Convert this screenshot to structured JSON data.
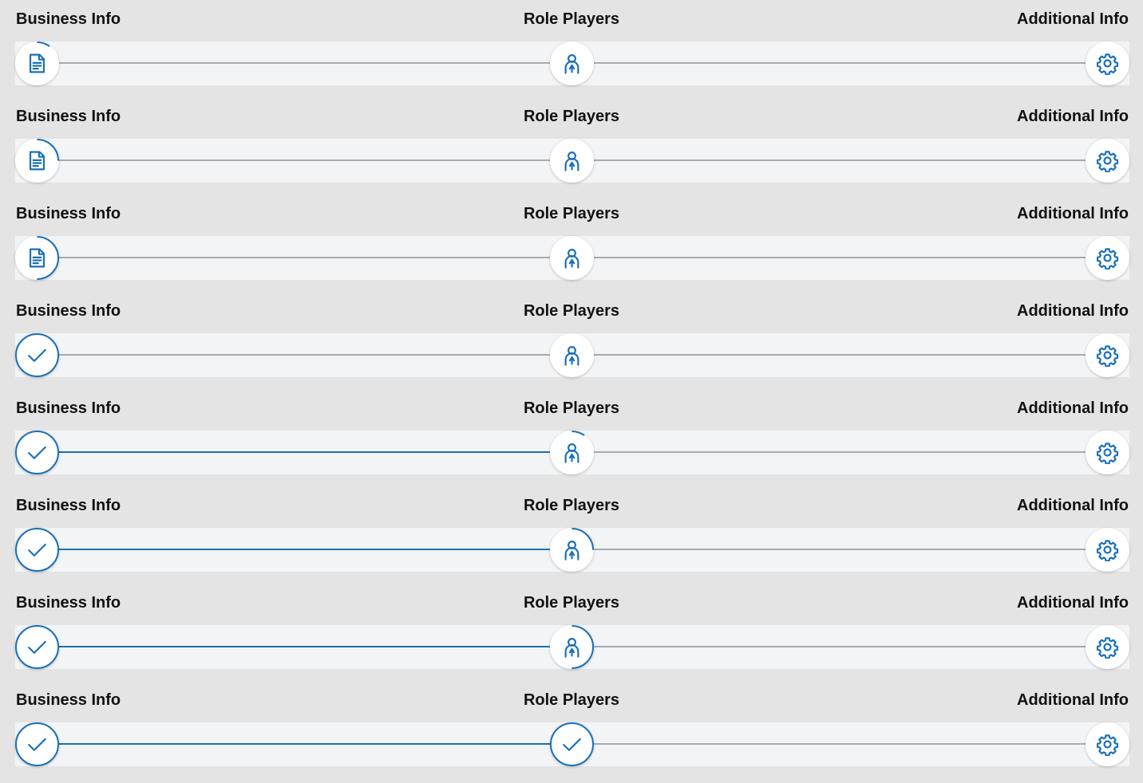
{
  "colors": {
    "accent": "#1a70b8",
    "connector_inactive": "#a7abb0",
    "track": "#f3f4f6",
    "background": "#e4e4e4"
  },
  "steppers": [
    {
      "steps": [
        {
          "label": "Business Info",
          "icon": "document-icon",
          "progress": 0.1
        },
        {
          "label": "Role Players",
          "icon": "person-icon",
          "progress": 0
        },
        {
          "label": "Additional Info",
          "icon": "gear-icon",
          "progress": 0
        }
      ],
      "connectors_complete": [
        false,
        false
      ]
    },
    {
      "steps": [
        {
          "label": "Business Info",
          "icon": "document-icon",
          "progress": 0.25
        },
        {
          "label": "Role Players",
          "icon": "person-icon",
          "progress": 0
        },
        {
          "label": "Additional Info",
          "icon": "gear-icon",
          "progress": 0
        }
      ],
      "connectors_complete": [
        false,
        false
      ]
    },
    {
      "steps": [
        {
          "label": "Business Info",
          "icon": "document-icon",
          "progress": 0.5
        },
        {
          "label": "Role Players",
          "icon": "person-icon",
          "progress": 0
        },
        {
          "label": "Additional Info",
          "icon": "gear-icon",
          "progress": 0
        }
      ],
      "connectors_complete": [
        false,
        false
      ]
    },
    {
      "steps": [
        {
          "label": "Business Info",
          "icon": "check-icon",
          "progress": 1
        },
        {
          "label": "Role Players",
          "icon": "person-icon",
          "progress": 0
        },
        {
          "label": "Additional Info",
          "icon": "gear-icon",
          "progress": 0
        }
      ],
      "connectors_complete": [
        false,
        false
      ]
    },
    {
      "steps": [
        {
          "label": "Business Info",
          "icon": "check-icon",
          "progress": 1
        },
        {
          "label": "Role Players",
          "icon": "person-icon",
          "progress": 0.1
        },
        {
          "label": "Additional Info",
          "icon": "gear-icon",
          "progress": 0
        }
      ],
      "connectors_complete": [
        true,
        false
      ]
    },
    {
      "steps": [
        {
          "label": "Business Info",
          "icon": "check-icon",
          "progress": 1
        },
        {
          "label": "Role Players",
          "icon": "person-icon",
          "progress": 0.25
        },
        {
          "label": "Additional Info",
          "icon": "gear-icon",
          "progress": 0
        }
      ],
      "connectors_complete": [
        true,
        false
      ]
    },
    {
      "steps": [
        {
          "label": "Business Info",
          "icon": "check-icon",
          "progress": 1
        },
        {
          "label": "Role Players",
          "icon": "person-icon",
          "progress": 0.5
        },
        {
          "label": "Additional Info",
          "icon": "gear-icon",
          "progress": 0
        }
      ],
      "connectors_complete": [
        true,
        false
      ]
    },
    {
      "steps": [
        {
          "label": "Business Info",
          "icon": "check-icon",
          "progress": 1
        },
        {
          "label": "Role Players",
          "icon": "check-icon",
          "progress": 1
        },
        {
          "label": "Additional Info",
          "icon": "gear-icon",
          "progress": 0
        }
      ],
      "connectors_complete": [
        true,
        false
      ]
    }
  ]
}
